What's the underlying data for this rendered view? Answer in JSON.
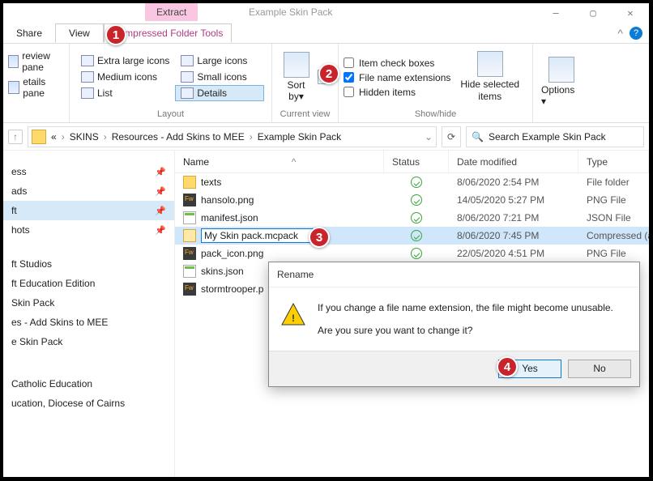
{
  "title_context_tab": "Extract",
  "title_folder_name": "Example Skin Pack",
  "window_controls": {
    "min": "—",
    "max": "▢",
    "close": "✕"
  },
  "tabs": {
    "share": "Share",
    "view": "View",
    "ctx": "Compressed Folder Tools"
  },
  "ribbon_help": {
    "chevron": "^"
  },
  "panes": {
    "preview": "review pane",
    "details": "etails pane"
  },
  "layout": {
    "xl": "Extra large icons",
    "lg": "Large icons",
    "md": "Medium icons",
    "sm": "Small icons",
    "list": "List",
    "details": "Details",
    "group_label": "Layout"
  },
  "sort": {
    "label": "Sort by",
    "drop": "▾",
    "group_label": "Current view"
  },
  "checks": {
    "item": "Item check boxes",
    "ext": "File name extensions",
    "hidden": "Hidden items",
    "group_label": "Show/hide"
  },
  "hide_btn": {
    "l1": "Hide selected",
    "l2": "items"
  },
  "options_btn": "Options",
  "breadcrumbs": [
    "«",
    "SKINS",
    "Resources - Add Skins to MEE",
    "Example Skin Pack"
  ],
  "search_placeholder": "Search Example Skin Pack",
  "nav": {
    "quick": [
      "ess",
      "ads",
      "ft",
      "hots"
    ],
    "recent": [
      "ft Studios",
      "ft Education Edition",
      "Skin Pack",
      "es - Add Skins to MEE",
      "e Skin Pack"
    ],
    "bottom": [
      "Catholic Education",
      "ucation, Diocese of Cairns"
    ]
  },
  "columns": {
    "name": "Name",
    "status": "Status",
    "date": "Date modified",
    "type": "Type"
  },
  "files": [
    {
      "icon": "folder",
      "name": "texts",
      "date": "8/06/2020 2:54 PM",
      "type": "File folder"
    },
    {
      "icon": "png",
      "name": "hansolo.png",
      "date": "14/05/2020 5:27 PM",
      "type": "PNG File"
    },
    {
      "icon": "json",
      "name": "manifest.json",
      "date": "8/06/2020 7:21 PM",
      "type": "JSON File"
    },
    {
      "icon": "zip",
      "name": "My Skin pack.mcpack",
      "date": "8/06/2020 7:45 PM",
      "type": "Compressed (a",
      "sel": true,
      "editing": true
    },
    {
      "icon": "png",
      "name": "pack_icon.png",
      "date": "22/05/2020 4:51 PM",
      "type": "PNG File"
    },
    {
      "icon": "json",
      "name": "skins.json",
      "date": "",
      "type": ""
    },
    {
      "icon": "png",
      "name": "stormtrooper.p",
      "date": "",
      "type": ""
    }
  ],
  "dialog": {
    "title": "Rename",
    "line1": "If you change a file name extension, the file might become unusable.",
    "line2": "Are you sure you want to change it?",
    "yes": "Yes",
    "no": "No"
  },
  "badges": {
    "1": "1",
    "2": "2",
    "3": "3",
    "4": "4"
  }
}
